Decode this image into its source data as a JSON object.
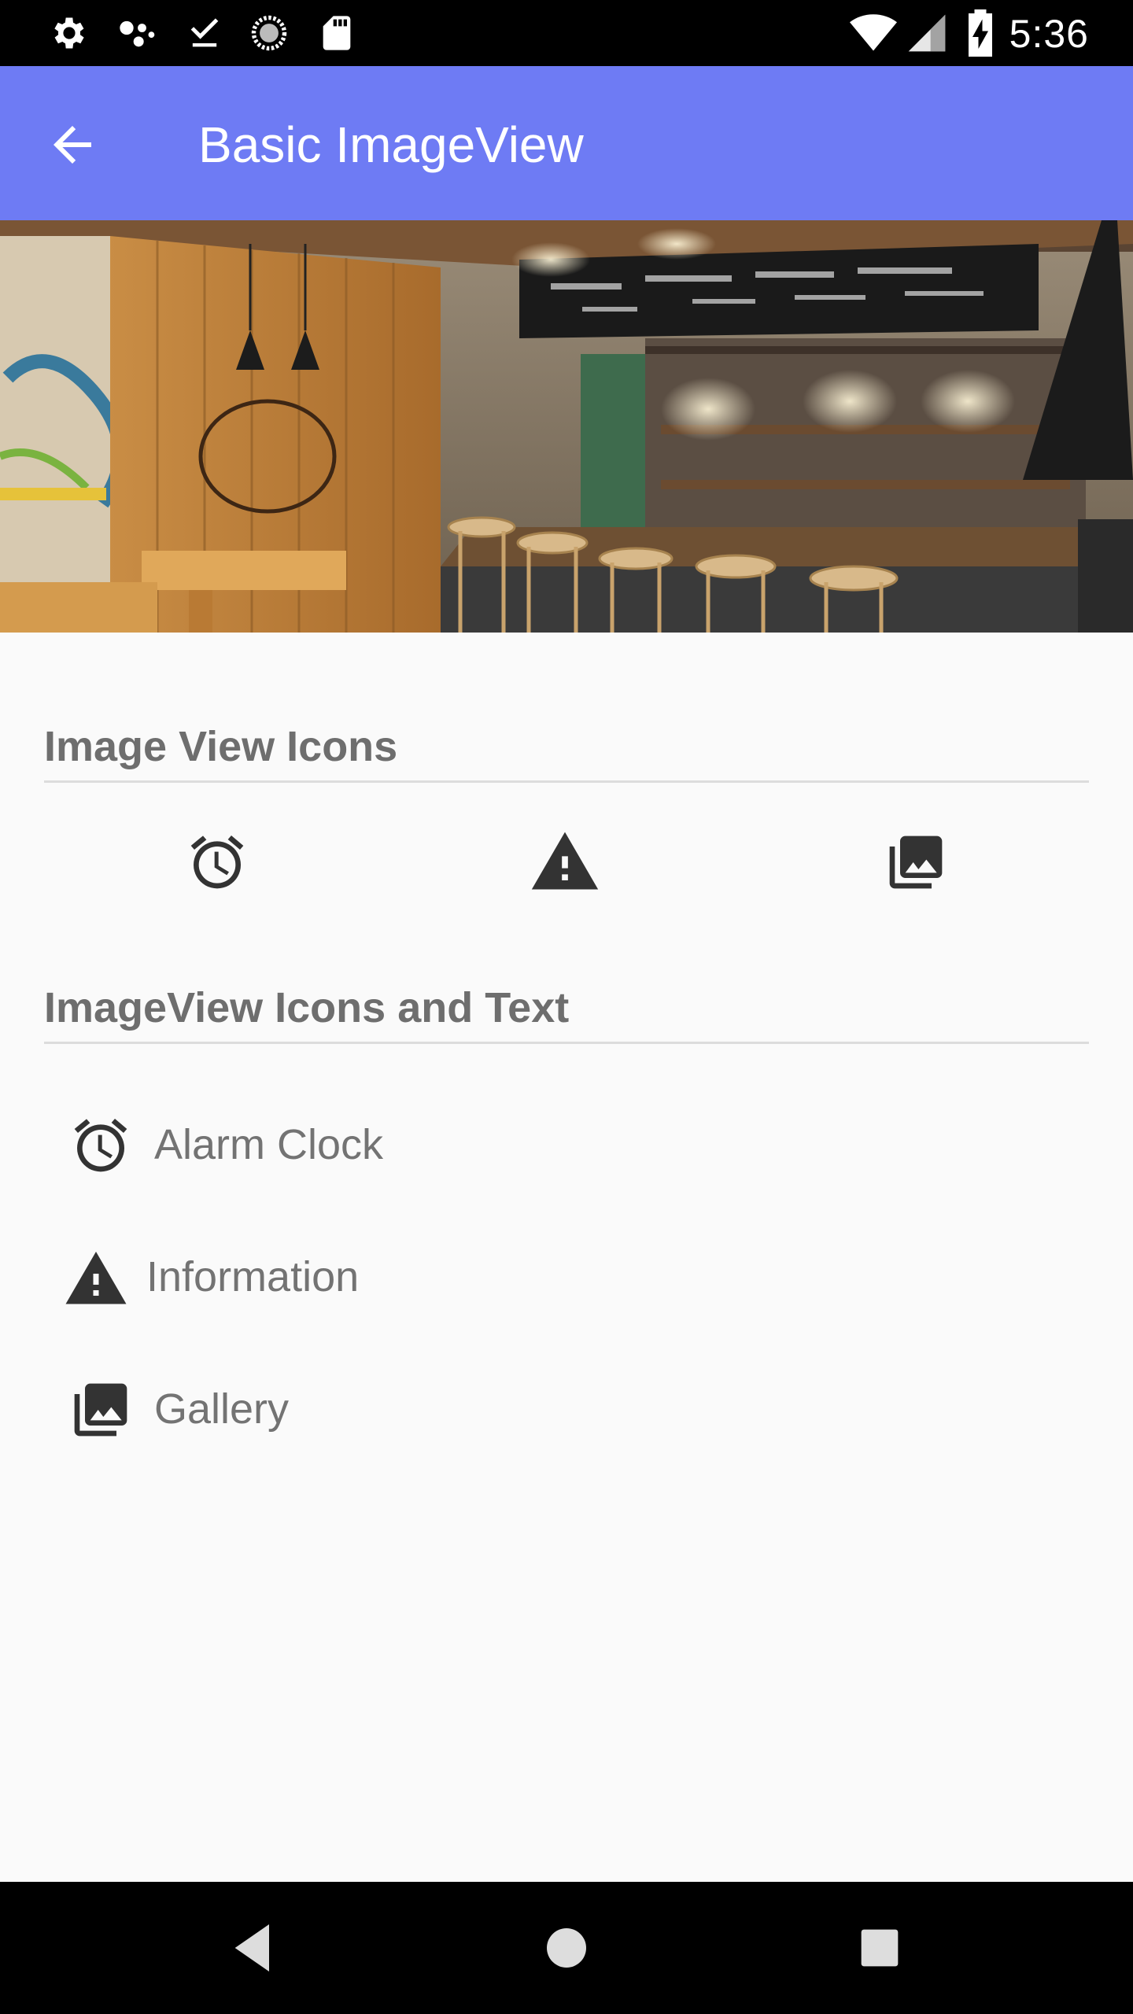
{
  "status_bar": {
    "time": "5:36",
    "icons": [
      "settings-icon",
      "assistant-icon",
      "download-done-icon",
      "sync-icon",
      "sd-card-icon",
      "wifi-icon",
      "cell-signal-icon",
      "battery-charging-icon"
    ]
  },
  "app_bar": {
    "title": "Basic ImageView",
    "back_icon": "arrow-back-icon",
    "color": "#6e7bf4"
  },
  "hero": {
    "description_icon": "coffee-shop-photo"
  },
  "section1": {
    "heading": "Image View Icons",
    "icons": [
      "alarm-icon",
      "warning-icon",
      "gallery-icon"
    ]
  },
  "section2": {
    "heading": "ImageView Icons and Text",
    "items": [
      {
        "icon": "alarm-icon",
        "label": "Alarm Clock"
      },
      {
        "icon": "warning-icon",
        "label": "Information"
      },
      {
        "icon": "gallery-icon",
        "label": "Gallery"
      }
    ]
  },
  "nav_bar": {
    "buttons": [
      "back-nav-icon",
      "home-nav-icon",
      "recents-nav-icon"
    ]
  }
}
